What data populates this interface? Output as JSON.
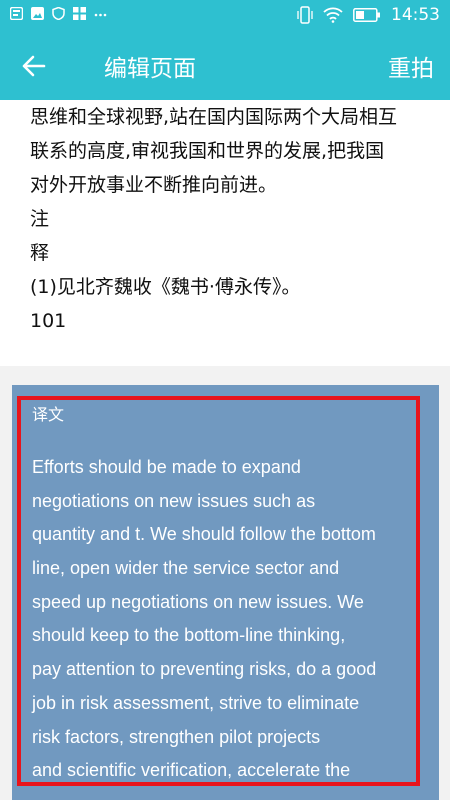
{
  "status_bar": {
    "time": "14:53",
    "left_icons": [
      "notification-icon",
      "image-icon",
      "shield-icon",
      "apps-icon",
      "more-icon"
    ],
    "right_icons": [
      "vibrate-icon",
      "wifi-icon",
      "battery-icon"
    ]
  },
  "app_bar": {
    "title": "编辑页面",
    "reshoot_label": "重拍",
    "background": "#2ec0d0"
  },
  "ocr_text": {
    "lines": [
      "思维和全球视野,站在国内国际两个大局相互",
      "联系的高度,审视我国和世界的发展,把我国",
      "对外开放事业不断推向前进。",
      "注",
      "释",
      "(1)见北齐魏收《魏书·傅永传》。",
      "101"
    ]
  },
  "translation": {
    "title": "译文",
    "lines": [
      "Efforts should be made to expand",
      "negotiations on new issues such as",
      "quantity and t. We should follow the bottom",
      "line, open wider the service sector and",
      "speed up negotiations on new issues. We",
      "should keep to the bottom-line thinking,",
      "pay attention to preventing risks, do a good",
      "job in risk assessment, strive to eliminate",
      "risk factors, strengthen pilot projects",
      "and scientific verification, accelerate the"
    ],
    "panel_color": "#7199c0",
    "highlight_color": "#e8141c"
  }
}
